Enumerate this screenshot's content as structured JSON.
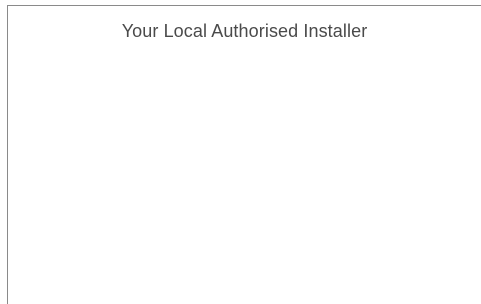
{
  "panel": {
    "title": "Your Local Authorised Installer"
  }
}
